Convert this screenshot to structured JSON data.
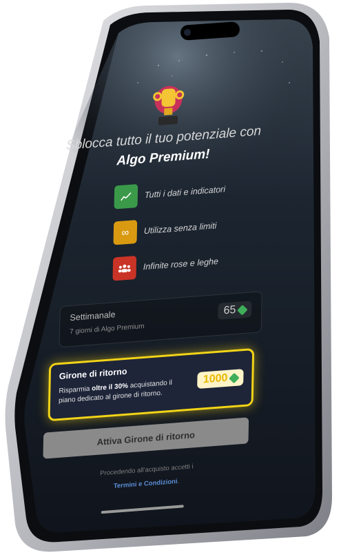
{
  "headline": {
    "line1": "Sblocca tutto il tuo potenziale con",
    "line2": "Algo Premium!"
  },
  "features": [
    {
      "icon": "chart-icon",
      "label": "Tutti i dati e indicatori",
      "color": "#3a9a4a"
    },
    {
      "icon": "infinity-icon",
      "label": "Utilizza senza limiti",
      "color": "#d99a12"
    },
    {
      "icon": "people-icon",
      "label": "Infinite rose e leghe",
      "color": "#c93426"
    }
  ],
  "plans": {
    "weekly": {
      "title": "Settimanale",
      "subtitle": "7 giorni di Algo Premium",
      "price": "65"
    },
    "return": {
      "title": "Girone di ritorno",
      "desc_pre": "Risparmia ",
      "desc_bold": "oltre il 30%",
      "desc_post": " acquistando il piano dedicato al girone di ritorno.",
      "price": "1000",
      "border_color": "#f2d417"
    }
  },
  "cta": {
    "label": "Attiva Girone di ritorno"
  },
  "legal": {
    "text": "Procedendo all'acquisto accetti i",
    "link": "Termini e Condizioni",
    "suffix": "."
  }
}
